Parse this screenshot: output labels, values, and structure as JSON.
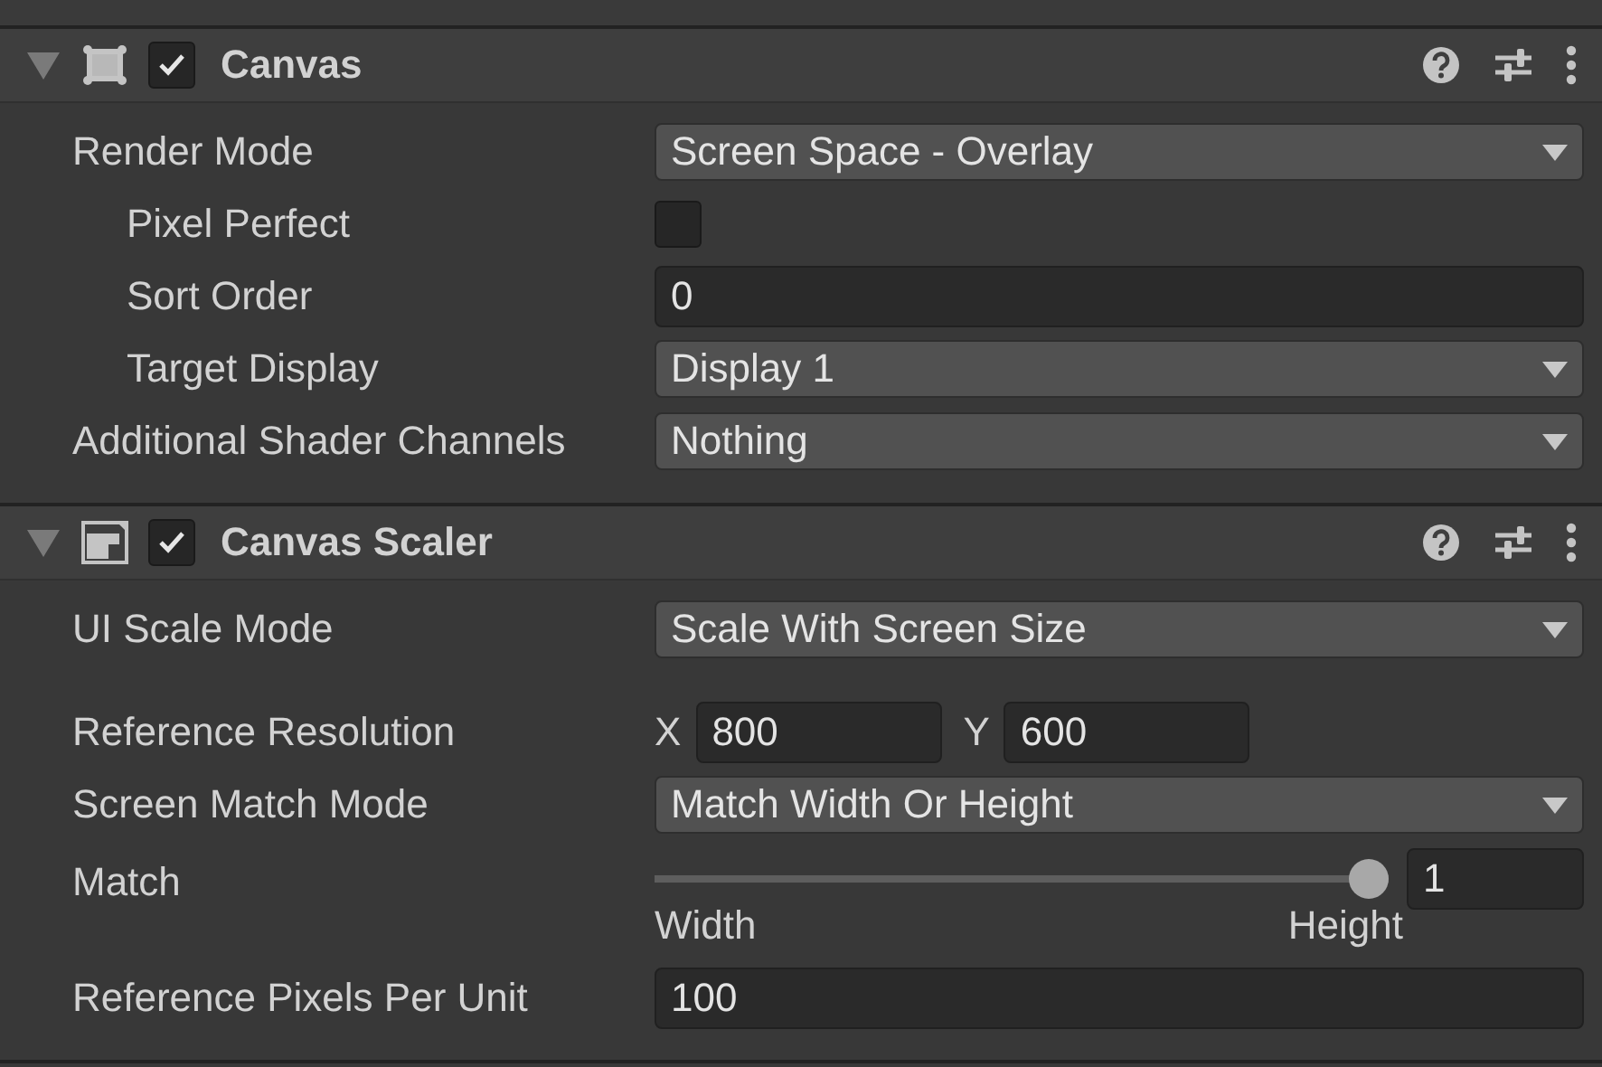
{
  "components": [
    {
      "kind": "canvas",
      "title": "Canvas",
      "enabled": true,
      "expanded": true,
      "fields": [
        {
          "kind": "dropdown",
          "label": "Render Mode",
          "indented": false,
          "value": "Screen Space - Overlay"
        },
        {
          "kind": "checkbox",
          "label": "Pixel Perfect",
          "indented": true,
          "checked": false
        },
        {
          "kind": "text",
          "label": "Sort Order",
          "indented": true,
          "value": "0"
        },
        {
          "kind": "dropdown",
          "label": "Target Display",
          "indented": true,
          "value": "Display 1"
        },
        {
          "kind": "dropdown",
          "label": "Additional Shader Channels",
          "indented": false,
          "value": "Nothing"
        }
      ]
    },
    {
      "kind": "scaler",
      "title": "Canvas Scaler",
      "enabled": true,
      "expanded": true,
      "fields": [
        {
          "kind": "dropdown",
          "label": "UI Scale Mode",
          "indented": false,
          "value": "Scale With Screen Size"
        },
        {
          "kind": "vector2",
          "label": "Reference Resolution",
          "indented": false,
          "parts": [
            {
              "label": "X",
              "value": "800"
            },
            {
              "label": "Y",
              "value": "600"
            }
          ]
        },
        {
          "kind": "dropdown",
          "label": "Screen Match Mode",
          "indented": false,
          "value": "Match Width Or Height"
        },
        {
          "kind": "slider",
          "label": "Match",
          "indented": false,
          "level": 1,
          "value": "1",
          "min_label": "Width",
          "max_label": "Height"
        },
        {
          "kind": "text",
          "label": "Reference Pixels Per Unit",
          "indented": false,
          "value": "100"
        }
      ]
    }
  ]
}
